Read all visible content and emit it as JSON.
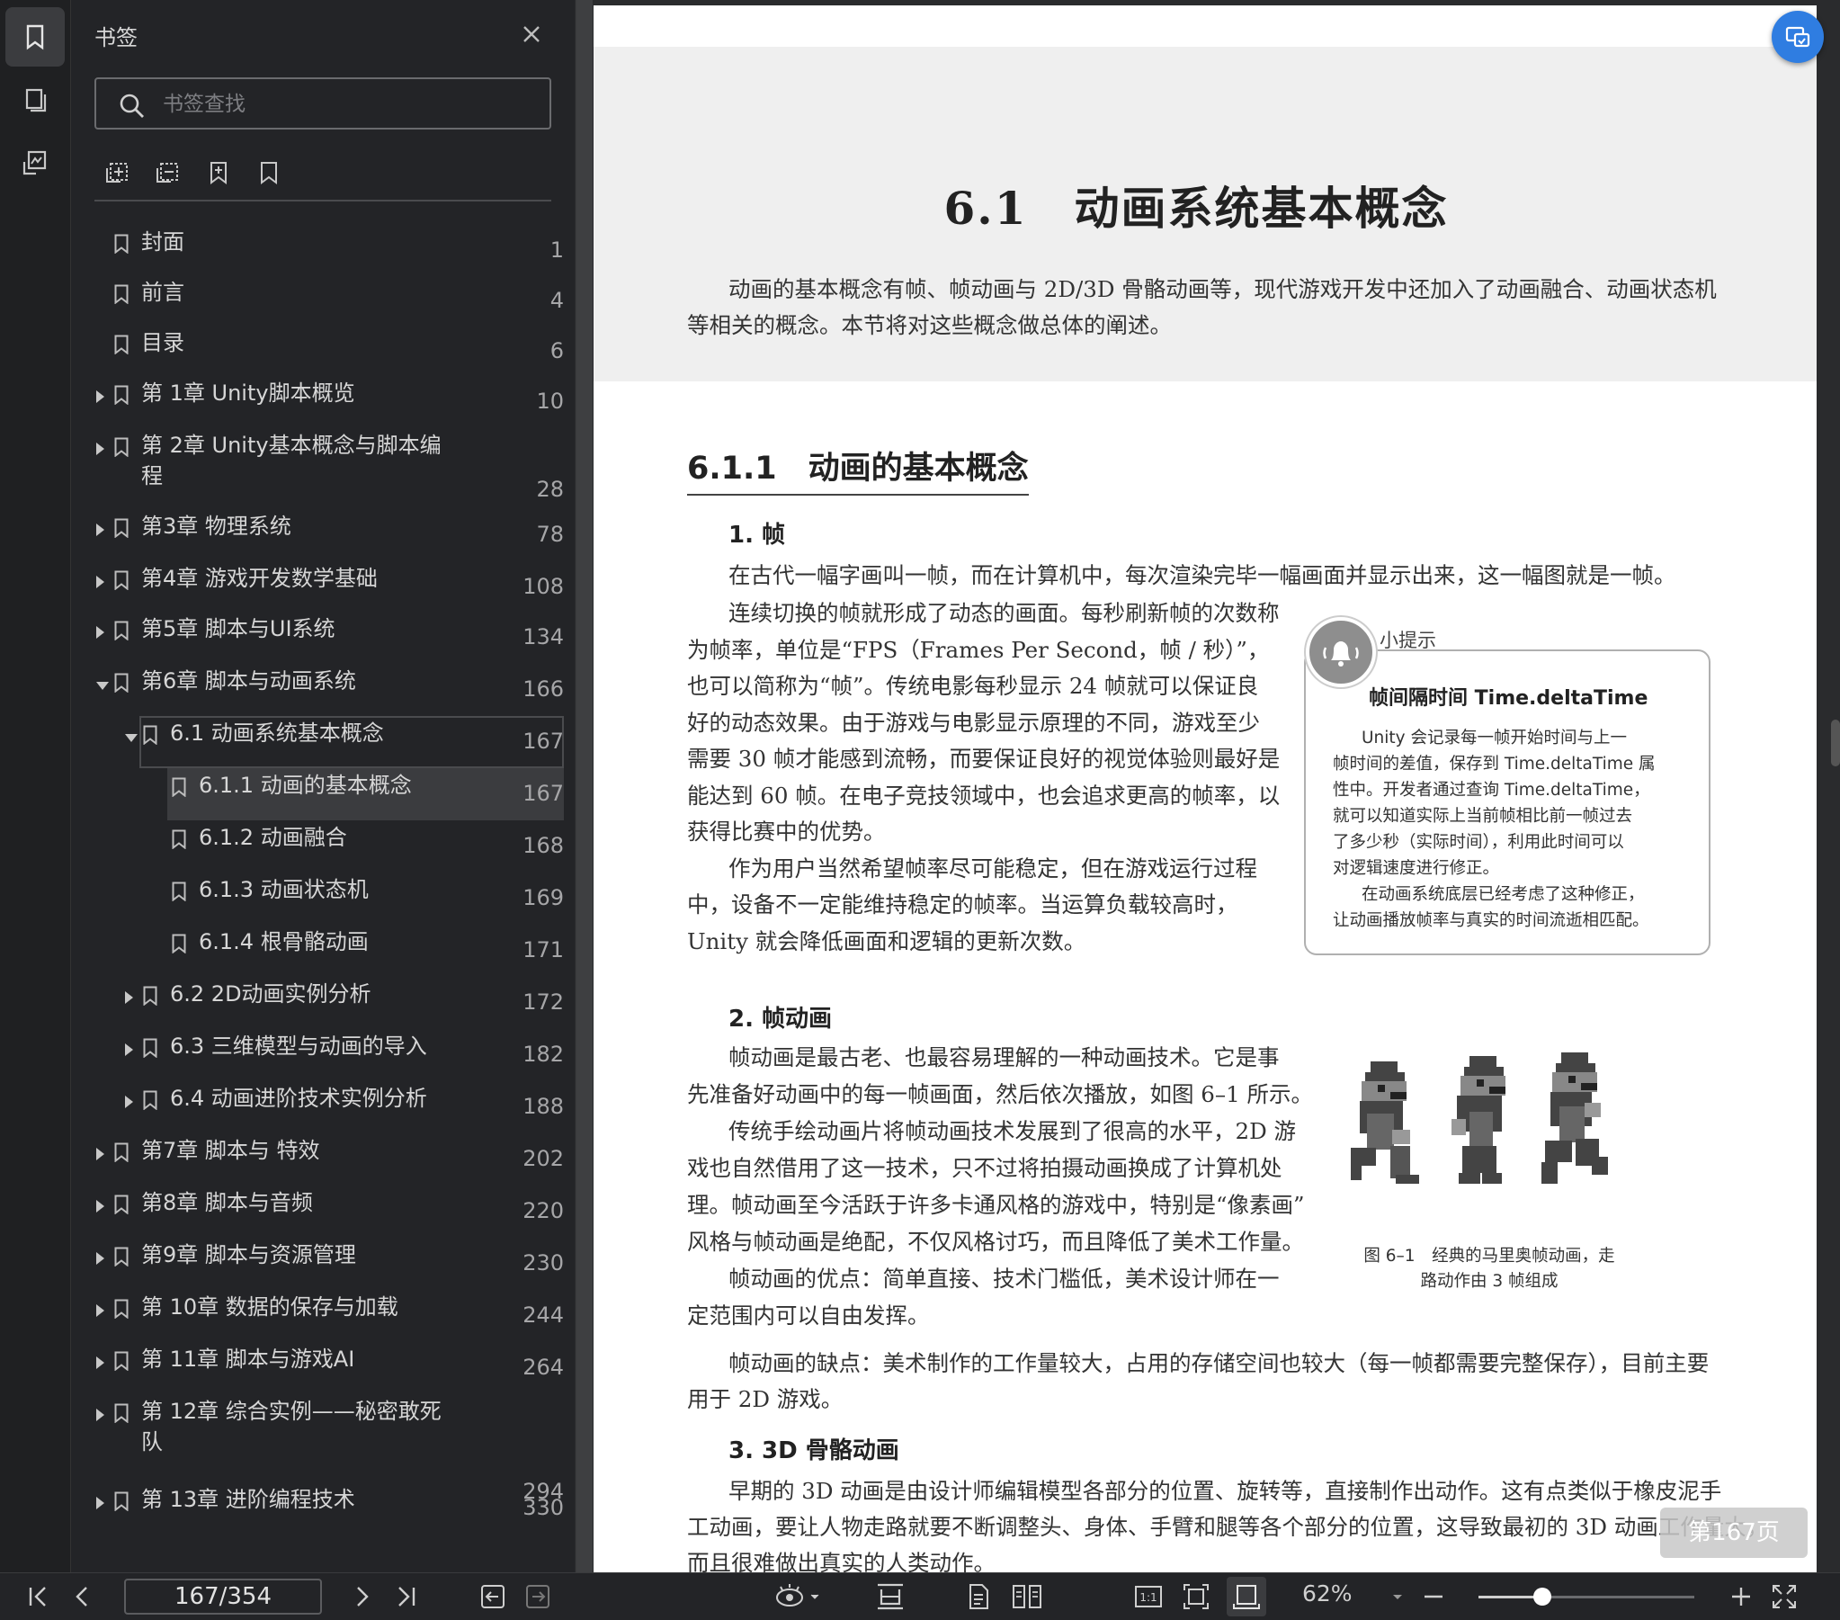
{
  "sidebar": {
    "title": "书签",
    "search_placeholder": "书签查找"
  },
  "bookmarks": [
    {
      "label": "封面",
      "page": "1"
    },
    {
      "label": "前言",
      "page": "4"
    },
    {
      "label": "目录",
      "page": "6"
    },
    {
      "label": "第 1章 Unity脚本概览",
      "page": "10"
    },
    {
      "label": "第 2章 Unity基本概念与脚本编程",
      "page": "28"
    },
    {
      "label": "第3章 物理系统",
      "page": "78"
    },
    {
      "label": "第4章 游戏开发数学基础",
      "page": "108"
    },
    {
      "label": "第5章 脚本与UI系统",
      "page": "134"
    },
    {
      "label": "第6章 脚本与动画系统",
      "page": "166"
    },
    {
      "label": "6.1 动画系统基本概念",
      "page": "167"
    },
    {
      "label": "6.1.1 动画的基本概念",
      "page": "167"
    },
    {
      "label": "6.1.2 动画融合",
      "page": "168"
    },
    {
      "label": "6.1.3 动画状态机",
      "page": "169"
    },
    {
      "label": "6.1.4 根骨骼动画",
      "page": "171"
    },
    {
      "label": "6.2 2D动画实例分析",
      "page": "172"
    },
    {
      "label": "6.3 三维模型与动画的导入",
      "page": "182"
    },
    {
      "label": "6.4 动画进阶技术实例分析",
      "page": "188"
    },
    {
      "label": "第7章 脚本与 特效",
      "page": "202"
    },
    {
      "label": "第8章 脚本与音频",
      "page": "220"
    },
    {
      "label": "第9章 脚本与资源管理",
      "page": "230"
    },
    {
      "label": "第 10章 数据的保存与加载",
      "page": "244"
    },
    {
      "label": "第 11章 脚本与游戏AI",
      "page": "264"
    },
    {
      "label": "第 12章 综合实例——秘密敢死队",
      "page": "294"
    },
    {
      "label": "第 13章 进阶编程技术",
      "page": "330"
    }
  ],
  "document": {
    "section_title": "6.1　动画系统基本概念",
    "intro_1": "动画的基本概念有帧、帧动画与 2D/3D 骨骼动画等，现代游戏开发中还加入了动画融合、动画状态机",
    "intro_2": "等相关的概念。本节将对这些概念做总体的阐述。",
    "subsection_title": "6.1.1　动画的基本概念",
    "h_frame": "1. 帧",
    "frame_p1": "在古代一幅字画叫一帧，而在计算机中，每次渲染完毕一幅画面并显示出来，这一幅图就是一帧。",
    "frame_lines": [
      "连续切换的帧就形成了动态的画面。每秒刷新帧的次数称",
      "为帧率，单位是“FPS（Frames Per Second，帧 / 秒）”，",
      "也可以简称为“帧”。传统电影每秒显示 24 帧就可以保证良",
      "好的动态效果。由于游戏与电影显示原理的不同，游戏至少",
      "需要 30 帧才能感到流畅，而要保证良好的视觉体验则最好是",
      "能达到 60 帧。在电子竞技领域中，也会追求更高的帧率，以",
      "获得比赛中的优势。",
      "作为用户当然希望帧率尽可能稳定，但在游戏运行过程",
      "中，设备不一定能维持稳定的帧率。当运算负载较高时，",
      "Unity 就会降低画面和逻辑的更新次数。"
    ],
    "tip_label": "小提示",
    "tip_title": "帧间隔时间 Time.deltaTime",
    "tip_lines": [
      "Unity 会记录每一帧开始时间与上一",
      "帧时间的差值，保存到 Time.deltaTime 属",
      "性中。开发者通过查询 Time.deltaTime，",
      "就可以知道实际上当前帧相比前一帧过去",
      "了多少秒（实际时间），利用此时间可以",
      "对逻辑速度进行修正。",
      "在动画系统底层已经考虑了这种修正，",
      "让动画播放帧率与真实的时间流逝相匹配。"
    ],
    "h_anim": "2. 帧动画",
    "anim_lines": [
      "帧动画是最古老、也最容易理解的一种动画技术。它是事",
      "先准备好动画中的每一帧画面，然后依次播放，如图 6–1 所示。",
      "传统手绘动画片将帧动画技术发展到了很高的水平，2D 游",
      "戏也自然借用了这一技术，只不过将拍摄动画换成了计算机处",
      "理。帧动画至今活跃于许多卡通风格的游戏中，特别是“像素画”",
      "风格与帧动画是绝配，不仅风格讨巧，而且降低了美术工作量。",
      "帧动画的优点：简单直接、技术门槛低，美术设计师在一",
      "定范围内可以自由发挥。"
    ],
    "anim_cons_1": "帧动画的缺点：美术制作的工作量较大，占用的存储空间也较大（每一帧都需要完整保存），目前主要",
    "anim_cons_2": "用于 2D 游戏。",
    "figure_caption_1": "图 6–1　经典的马里奥帧动画，走",
    "figure_caption_2": "路动作由 3 帧组成",
    "h_3d": "3. 3D 骨骼动画",
    "bone_1": "早期的 3D 动画是由设计师编辑模型各部分的位置、旋转等，直接制作出动作。这有点类似于橡皮泥手",
    "bone_2": "工动画，要让人物走路就要不断调整头、身体、手臂和腿等各个部分的位置，这导致最初的 3D 动画工作量大，",
    "bone_3": "而且很难做出真实的人类动作。"
  },
  "overlay": {
    "page_indicator": "第167页"
  },
  "bottombar": {
    "page_value": "167/354",
    "zoom_label": "62%",
    "zoom_fraction": 0.62
  }
}
